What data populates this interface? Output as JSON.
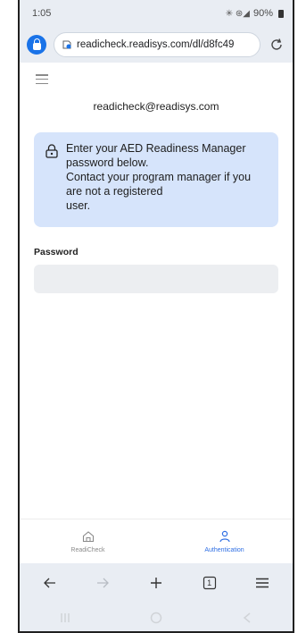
{
  "status_bar": {
    "time": "1:05",
    "signal_glyphs": "✳ ⊛◢",
    "battery": "90%"
  },
  "browser": {
    "url": "readicheck.readisys.com/dl/d8fc49"
  },
  "page": {
    "email": "readicheck@readisys.com",
    "info_lines": [
      "Enter your AED Readiness Manager",
      "password below.",
      "Contact your program manager if you",
      "are not a registered",
      "user."
    ],
    "password_label": "Password",
    "password_value": "",
    "password_placeholder": ""
  },
  "app_nav": {
    "items": [
      {
        "label": "ReadiCheck",
        "icon": "home-icon",
        "active": false
      },
      {
        "label": "Authentication",
        "icon": "person-icon",
        "active": true
      }
    ]
  },
  "browser_toolbar": {
    "tab_count": "1"
  },
  "colors": {
    "accent": "#1a73e8",
    "info_bg": "#d6e4fb",
    "active_nav": "#2f6fe4",
    "input_bg": "#eceef1"
  }
}
